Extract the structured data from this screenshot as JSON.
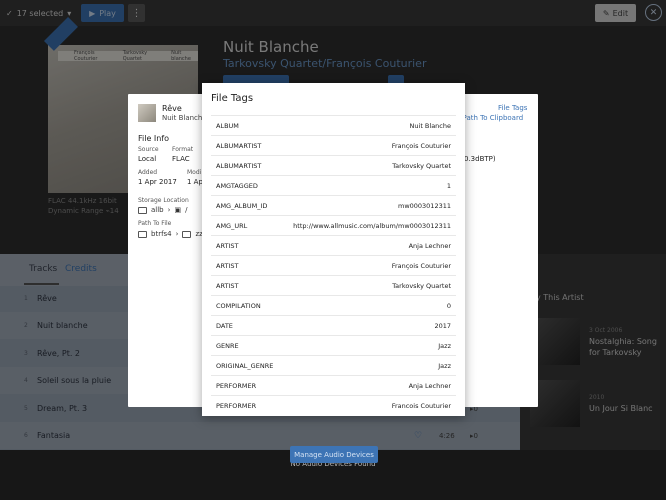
{
  "toolbar": {
    "selected_label": "17 selected",
    "play_label": "Play",
    "edit_label": "Edit"
  },
  "album": {
    "title": "Nuit Blanche",
    "artist1": "Tarkovsky Quartet",
    "separator": "/",
    "artist2": "François Couturier",
    "cover_artist": "François Couturier",
    "cover_group": "Tarkovsky Quartet",
    "cover_title": "Nuit blanche",
    "format_line": "FLAC 44.1kHz 16bit",
    "dynamic_range": "Dynamic Range",
    "dynamic_value": "14"
  },
  "tabs": {
    "tracks": "Tracks",
    "credits": "Credits"
  },
  "tracks": [
    {
      "num": "1",
      "title": "Rêve"
    },
    {
      "num": "2",
      "title": "Nuit blanche"
    },
    {
      "num": "3",
      "title": "Rêve, Pt. 2"
    },
    {
      "num": "4",
      "title": "Soleil sous la pluie"
    },
    {
      "num": "5",
      "title": "Dream, Pt. 3",
      "plays": "0"
    },
    {
      "num": "6",
      "title": "Fantasia",
      "duration": "4:26",
      "plays": "0"
    }
  ],
  "right_panel": {
    "heading": "y This Artist",
    "items": [
      {
        "date": "3 Oct 2006",
        "title": "Nostalghia: Song for Tarkovsky"
      },
      {
        "date": "2010",
        "title": "Un Jour Si Blanc"
      }
    ]
  },
  "file_info": {
    "track_title": "Rêve",
    "track_sub": "Nuit Blanche",
    "heading": "File Info",
    "source_label": "Source",
    "source_value": "Local",
    "format_label": "Format",
    "format_value": "FLAC",
    "added_label": "Added",
    "added_value": "1 Apr 2017",
    "modified_label": "Modi",
    "modified_value": "1 Ap",
    "storage_label": "Storage Location",
    "storage_root": "allb",
    "storage_sep": "/",
    "path_label": "Path To File",
    "path_root": "btrfs4",
    "path_next": "zz",
    "link_file_tags": "File Tags",
    "link_copy_path": "e Path To Clipboard",
    "right_value": "0.3dBTP)"
  },
  "file_tags": {
    "title": "File Tags",
    "rows": [
      {
        "key": "ALBUM",
        "value": "Nuit Blanche"
      },
      {
        "key": "ALBUMARTIST",
        "value": "François Couturier"
      },
      {
        "key": "ALBUMARTIST",
        "value": "Tarkovsky Quartet"
      },
      {
        "key": "AMGTAGGED",
        "value": "1"
      },
      {
        "key": "AMG_ALBUM_ID",
        "value": "mw0003012311"
      },
      {
        "key": "AMG_URL",
        "value": "http://www.allmusic.com/album/mw0003012311"
      },
      {
        "key": "ARTIST",
        "value": "Anja Lechner"
      },
      {
        "key": "ARTIST",
        "value": "François Couturier"
      },
      {
        "key": "ARTIST",
        "value": "Tarkovsky Quartet"
      },
      {
        "key": "COMPILATION",
        "value": "0"
      },
      {
        "key": "DATE",
        "value": "2017"
      },
      {
        "key": "GENRE",
        "value": "Jazz"
      },
      {
        "key": "ORIGINAL_GENRE",
        "value": "Jazz"
      },
      {
        "key": "PERFORMER",
        "value": "Anja Lechner"
      },
      {
        "key": "PERFORMER",
        "value": "Francois Couturier"
      }
    ]
  },
  "bottom": {
    "no_devices": "No Audio Devices Found",
    "manage_label": "Manage Audio Devices"
  },
  "colors": {
    "accent": "#3d74b5",
    "tracks_bg": "#9aa6b4"
  }
}
